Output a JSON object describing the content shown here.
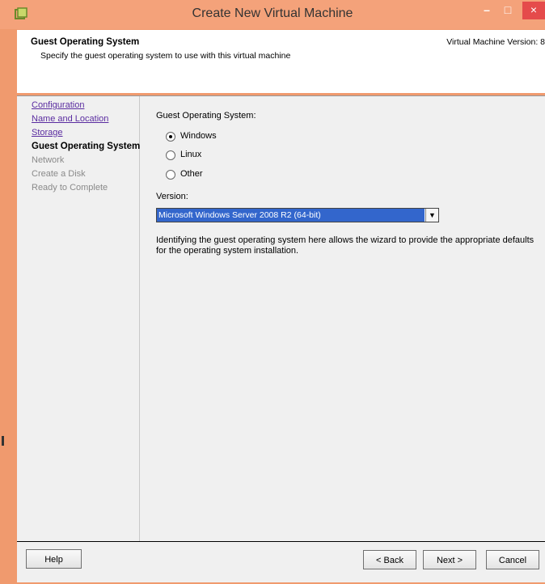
{
  "window": {
    "title": "Create New Virtual Machine",
    "controls": {
      "minimize": "–",
      "maximize": "□",
      "close": "×"
    },
    "app_icon": "vsphere-app-icon"
  },
  "header": {
    "title": "Guest Operating System",
    "subtitle": "Specify the guest operating system to use with this virtual machine",
    "version": "Virtual Machine Version: 8"
  },
  "nav": {
    "items": [
      {
        "label": "Configuration",
        "state": "link"
      },
      {
        "label": "Name and Location",
        "state": "link"
      },
      {
        "label": "Storage",
        "state": "link"
      },
      {
        "label": "Guest Operating System",
        "state": "current"
      },
      {
        "label": "Network",
        "state": "future"
      },
      {
        "label": "Create a Disk",
        "state": "future"
      },
      {
        "label": "Ready to Complete",
        "state": "future"
      }
    ]
  },
  "content": {
    "os_label": "Guest Operating System:",
    "os_options": [
      {
        "label": "Windows",
        "selected": true
      },
      {
        "label": "Linux",
        "selected": false
      },
      {
        "label": "Other",
        "selected": false
      }
    ],
    "version_label": "Version:",
    "version_value": "Microsoft Windows Server 2008 R2 (64-bit)",
    "description": "Identifying the guest operating system here allows the wizard to provide the appropriate defaults for the operating system installation."
  },
  "footer": {
    "help": "Help",
    "back": "< Back",
    "next": "Next >",
    "cancel": "Cancel"
  },
  "colors": {
    "titlebar": "#f4a27a",
    "close_button": "#e54b4b",
    "selection": "#3366cc",
    "link": "#5a2ca0"
  }
}
